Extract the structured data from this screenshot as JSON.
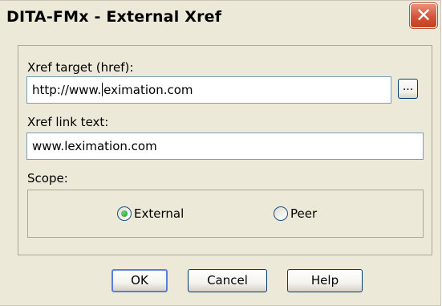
{
  "window": {
    "title": "DITA-FMx - External Xref",
    "close_glyph": "✕",
    "close_icon": "close-icon"
  },
  "form": {
    "href_label": "Xref target (href):",
    "href_value_before_caret": "http://www.",
    "href_value_after_caret": "eximation.com",
    "browse_label": "...",
    "link_text_label": "Xref link text:",
    "link_text_value": "www.leximation.com",
    "scope_label": "Scope:",
    "scope_options": [
      {
        "label": "External",
        "selected": true
      },
      {
        "label": "Peer",
        "selected": false
      }
    ]
  },
  "buttons": {
    "ok": "OK",
    "cancel": "Cancel",
    "help": "Help"
  },
  "colors": {
    "face": "#ece9d8",
    "close_red": "#d4533a",
    "textbox_border": "#7f9db9",
    "button_border": "#003c74",
    "radio_dot": "#21a121"
  }
}
